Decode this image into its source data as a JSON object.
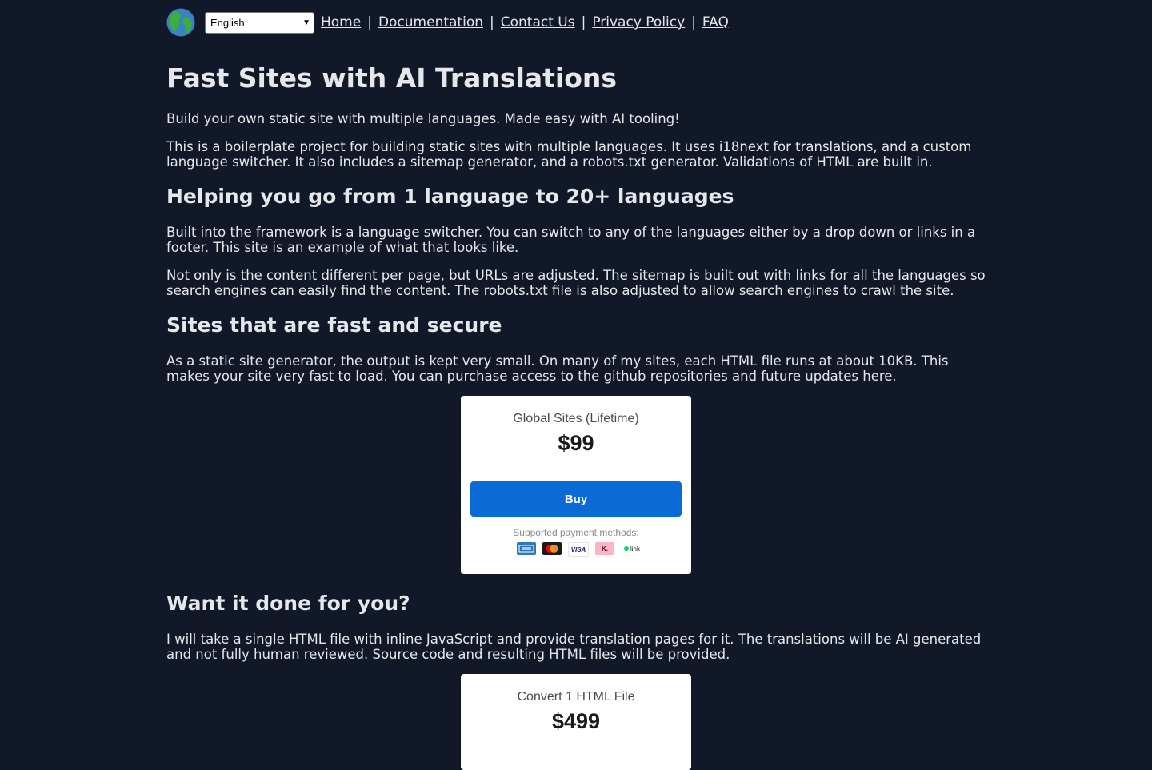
{
  "nav": {
    "language": "English",
    "links": [
      "Home",
      "Documentation",
      "Contact Us",
      "Privacy Policy",
      "FAQ"
    ],
    "separator": "|"
  },
  "main": {
    "title": "Fast Sites with AI Translations",
    "intro1": "Build your own static site with multiple languages. Made easy with AI tooling!",
    "intro2": "This is a boilerplate project for building static sites with multiple languages. It uses i18next for translations, and a custom language switcher. It also includes a sitemap generator, and a robots.txt generator. Validations of HTML are built in.",
    "h2_languages": "Helping you go from 1 language to 20+ languages",
    "lang_p1": "Built into the framework is a language switcher. You can switch to any of the languages either by a drop down or links in a footer. This site is an example of what that looks like.",
    "lang_p2": "Not only is the content different per page, but URLs are adjusted. The sitemap is built out with links for all the languages so search engines can easily find the content. The robots.txt file is also adjusted to allow search engines to crawl the site.",
    "h2_fast": "Sites that are fast and secure",
    "fast_p": "As a static site generator, the output is kept very small. On many of my sites, each HTML file runs at about 10KB. This makes your site very fast to load. You can purchase access to the github repositories and future updates here.",
    "h2_done": "Want it done for you?",
    "done_p": "I will take a single HTML file with inline JavaScript and provide translation pages for it. The translations will be AI generated and not fully human reviewed. Source code and resulting HTML files will be provided."
  },
  "card1": {
    "title": "Global Sites (Lifetime)",
    "price": "$99",
    "buy": "Buy",
    "payment_label": "Supported payment methods:",
    "methods": [
      "amex-icon",
      "mastercard-icon",
      "visa-icon",
      "klarna-icon",
      "link-icon"
    ],
    "visa_text": "VISA",
    "klarna_text": "K.",
    "link_text": "link"
  },
  "card2": {
    "title": "Convert 1 HTML File",
    "price": "$499"
  },
  "colors": {
    "background": "#111827",
    "text": "#e5e7eb",
    "buy_button": "#0a6ad6"
  }
}
